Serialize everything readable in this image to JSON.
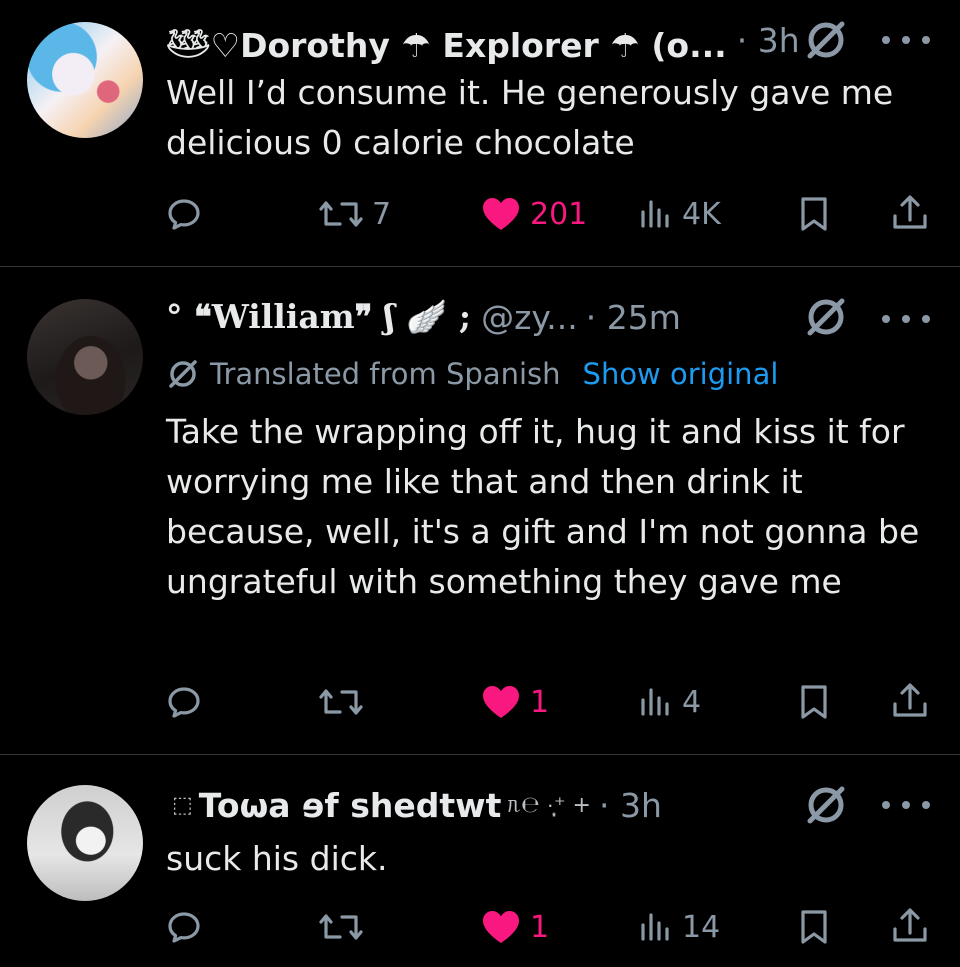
{
  "posts": [
    {
      "name": "𓅸♡Dorothy ☂ Explorer ☂ (o...",
      "handle": "",
      "time": "3h",
      "translated": false,
      "text": "Well I’d consume it. He generously gave me delicious 0 calorie chocolate",
      "replies": "",
      "reposts": "7",
      "likes": "201",
      "views": "4K"
    },
    {
      "name": "° ❝William❞ ʃ 🪽 ;",
      "handle": "@zy...",
      "time": "25m",
      "translated": true,
      "translated_label": "Translated from Spanish",
      "show_original": "Show original",
      "text": "Take the wrapping off it, hug it and kiss it for worrying me like that and then drink it because, well, it's a gift and I'm not gonna be ungrateful with something they gave me",
      "replies": "",
      "reposts": "",
      "likes": "1",
      "views": "4"
    },
    {
      "name": "Toωa ɘf shedtwt",
      "name_suffix": "ᥰ℮ ·̩͙⁺ +",
      "time": "3h",
      "translated": false,
      "text": "suck his dick.",
      "replies": "",
      "reposts": "",
      "likes": "1",
      "views": "14"
    }
  ],
  "icons": {
    "verified": "verified-icon",
    "more": "more-icon",
    "reply": "reply-icon",
    "repost": "repost-icon",
    "like": "heart-icon",
    "views": "views-icon",
    "bookmark": "bookmark-icon",
    "share": "share-icon"
  },
  "colors": {
    "background": "#000000",
    "text": "#e7e9ea",
    "muted": "#8b98a5",
    "like": "#f91880",
    "link": "#1d9bf0",
    "divider": "#2f3336"
  }
}
